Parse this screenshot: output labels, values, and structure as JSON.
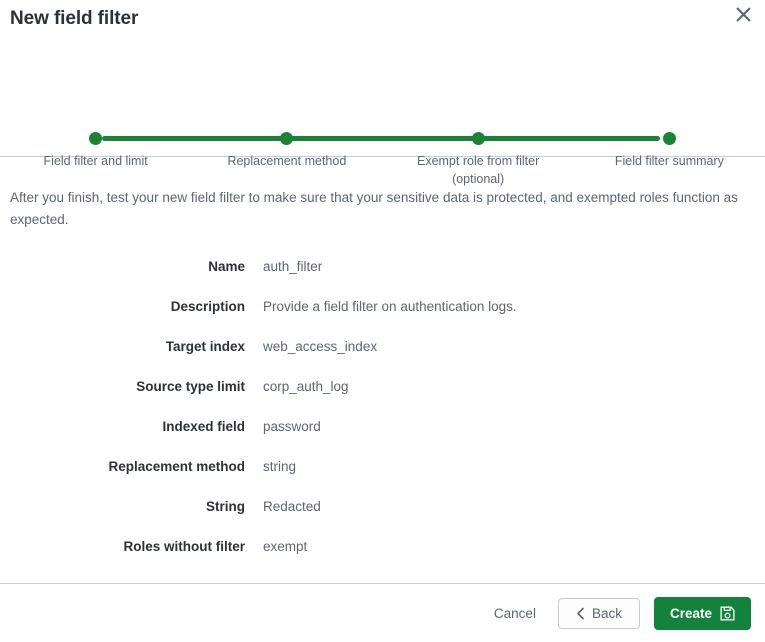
{
  "modal": {
    "title": "New field filter",
    "close_icon": "close-icon"
  },
  "stepper": {
    "accent_color": "#1b8334",
    "steps": [
      {
        "label": "Field filter and limit",
        "state": "complete"
      },
      {
        "label": "Replacement method",
        "state": "complete"
      },
      {
        "label": "Exempt role from filter\n(optional)",
        "state": "complete"
      },
      {
        "label": "Field filter summary",
        "state": "current"
      }
    ]
  },
  "body": {
    "intro": "After you finish, test your new field filter to make sure that your sensitive data is protected, and exempted roles function as expected.",
    "summary": [
      {
        "label": "Name",
        "value": "auth_filter"
      },
      {
        "label": "Description",
        "value": "Provide a field filter on authentication logs."
      },
      {
        "label": "Target index",
        "value": "web_access_index"
      },
      {
        "label": "Source type limit",
        "value": "corp_auth_log"
      },
      {
        "label": "Indexed field",
        "value": "password"
      },
      {
        "label": "Replacement method",
        "value": "string"
      },
      {
        "label": "String",
        "value": "Redacted"
      },
      {
        "label": "Roles without filter",
        "value": "exempt"
      }
    ]
  },
  "footer": {
    "cancel_label": "Cancel",
    "back_label": "Back",
    "back_icon": "chevron-left-icon",
    "create_label": "Create",
    "create_icon": "save-floppy-icon",
    "primary_color": "#13823c"
  }
}
